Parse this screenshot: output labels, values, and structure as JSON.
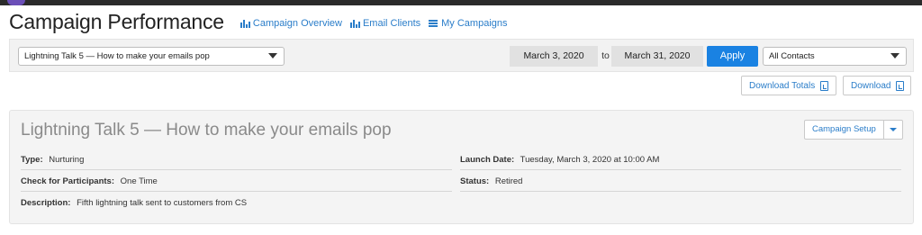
{
  "header": {
    "title": "Campaign Performance",
    "nav": [
      {
        "label": "Campaign Overview",
        "icon": "bar-chart-icon"
      },
      {
        "label": "Email Clients",
        "icon": "bar-chart-icon"
      },
      {
        "label": "My Campaigns",
        "icon": "list-icon"
      }
    ]
  },
  "filters": {
    "campaign_select": "Lightning Talk 5 — How to make your emails pop",
    "start_date": "March 3, 2020",
    "to_label": "to",
    "end_date": "March 31, 2020",
    "apply_label": "Apply",
    "contacts_select": "All Contacts"
  },
  "downloads": {
    "totals_label": "Download Totals",
    "download_label": "Download"
  },
  "campaign": {
    "title": "Lightning Talk 5 — How to make your emails pop",
    "setup_label": "Campaign Setup",
    "fields": {
      "type": {
        "key": "Type:",
        "value": "Nurturing"
      },
      "launch": {
        "key": "Launch Date:",
        "value": "Tuesday, March 3, 2020 at 10:00 AM"
      },
      "participants": {
        "key": "Check for Participants:",
        "value": "One Time"
      },
      "status": {
        "key": "Status:",
        "value": "Retired"
      },
      "description": {
        "key": "Description:",
        "value": "Fifth lightning talk sent to customers from CS"
      }
    }
  },
  "colors": {
    "accent": "#1a82e2",
    "link": "#2a7dc9"
  }
}
